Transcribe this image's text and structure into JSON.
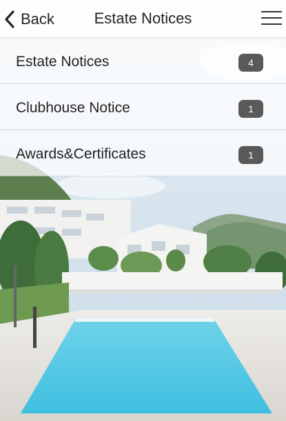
{
  "header": {
    "back_label": "Back",
    "title": "Estate Notices",
    "menu_icon": "hamburger-menu-icon",
    "back_icon": "chevron-left-icon"
  },
  "list": {
    "items": [
      {
        "label": "Estate Notices",
        "count": "4"
      },
      {
        "label": "Clubhouse Notice",
        "count": "1"
      },
      {
        "label": "Awards&Certificates",
        "count": "1"
      }
    ]
  },
  "colors": {
    "badge": "#595959",
    "pool": "#4fc9e6",
    "sky": "#dfeaf3"
  }
}
